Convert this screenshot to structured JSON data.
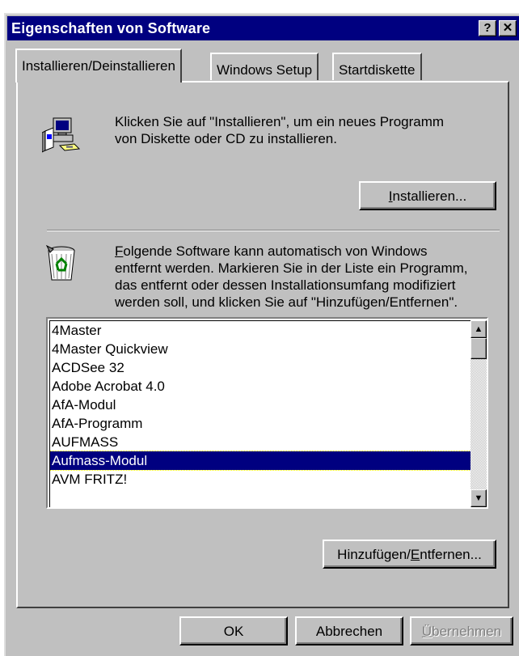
{
  "window": {
    "title": "Eigenschaften von Software",
    "help_button": "?",
    "close_button": "✕"
  },
  "tabs": [
    {
      "label": "Installieren/Deinstallieren",
      "active": true
    },
    {
      "label": "Windows Setup",
      "active": false
    },
    {
      "label": "Startdiskette",
      "active": false
    }
  ],
  "install_section": {
    "description_line1": "Klicken Sie auf \"Installieren\", um ein neues Programm",
    "description_line2": "von Diskette oder CD zu installieren.",
    "install_button_accel": "I",
    "install_button_rest": "nstallieren..."
  },
  "remove_section": {
    "desc_line1_accel": "F",
    "desc_line1_rest": "olgende Software kann automatisch von Windows",
    "desc_line2": "entfernt werden. Markieren Sie in der Liste ein Programm,",
    "desc_line3": "das entfernt oder dessen Installationsumfang modifiziert",
    "desc_line4": "werden soll, und klicken Sie auf \"Hinzufügen/Entfernen\".",
    "programs": [
      "4Master",
      "4Master Quickview",
      "ACDSee 32",
      "Adobe Acrobat 4.0",
      "AfA-Modul",
      "AfA-Programm",
      "AUFMASS",
      "Aufmass-Modul",
      "AVM FRITZ!"
    ],
    "selected_program": "Aufmass-Modul",
    "add_remove_prefix": "Hinzufügen/",
    "add_remove_accel": "E",
    "add_remove_rest": "ntfernen..."
  },
  "footer": {
    "ok_label": "OK",
    "cancel_label": "Abbrechen",
    "apply_accel": "Ü",
    "apply_rest": "bernehmen",
    "apply_enabled": false
  },
  "colors": {
    "titlebar": "#000080",
    "face": "#c0c0c0",
    "selection": "#000080"
  }
}
